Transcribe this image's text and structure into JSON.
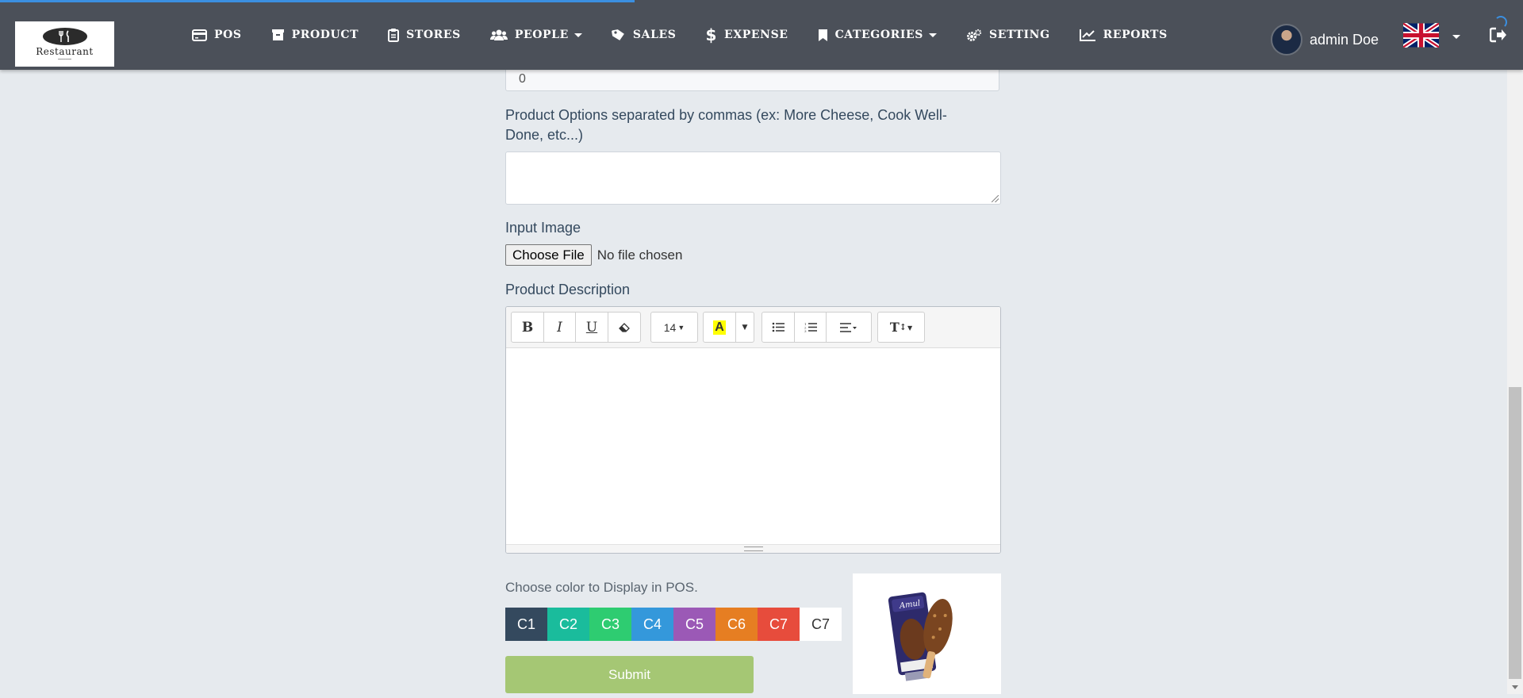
{
  "nav": {
    "logo_text": "Restaurant",
    "items": [
      {
        "label": "POS",
        "icon": "credit-card-icon"
      },
      {
        "label": "PRODUCT",
        "icon": "archive-icon"
      },
      {
        "label": "STORES",
        "icon": "clipboard-icon"
      },
      {
        "label": "PEOPLE",
        "icon": "users-icon",
        "dropdown": true
      },
      {
        "label": "SALES",
        "icon": "tag-icon"
      },
      {
        "label": "EXPENSE",
        "icon": "dollar-icon"
      },
      {
        "label": "CATEGORIES",
        "icon": "bookmark-icon",
        "dropdown": true
      },
      {
        "label": "SETTING",
        "icon": "cogs-icon"
      },
      {
        "label": "REPORTS",
        "icon": "line-chart-icon"
      }
    ],
    "user_name": "admin Doe",
    "language_flag": "uk-flag-icon"
  },
  "form": {
    "top_input_value": "0",
    "options_label": "Product Options separated by commas (ex: More Cheese, Cook Well-Done, etc...)",
    "options_value": "",
    "image_label": "Input Image",
    "file_button": "Choose File",
    "file_status": "No file chosen",
    "description_label": "Product Description",
    "editor": {
      "font_size": "14",
      "text_style_label": "T"
    },
    "color_label": "Choose color to Display in POS.",
    "colors": [
      {
        "label": "C1",
        "color": "#34495e"
      },
      {
        "label": "C2",
        "color": "#1abc9c"
      },
      {
        "label": "C3",
        "color": "#2ecc71"
      },
      {
        "label": "C4",
        "color": "#3498db"
      },
      {
        "label": "C5",
        "color": "#9b59b6"
      },
      {
        "label": "C6",
        "color": "#e67e22"
      },
      {
        "label": "C7",
        "color": "#e74c3c"
      },
      {
        "label": "C7",
        "color": "#ffffff"
      }
    ],
    "submit_label": "Submit",
    "preview_brand": "Amul"
  }
}
